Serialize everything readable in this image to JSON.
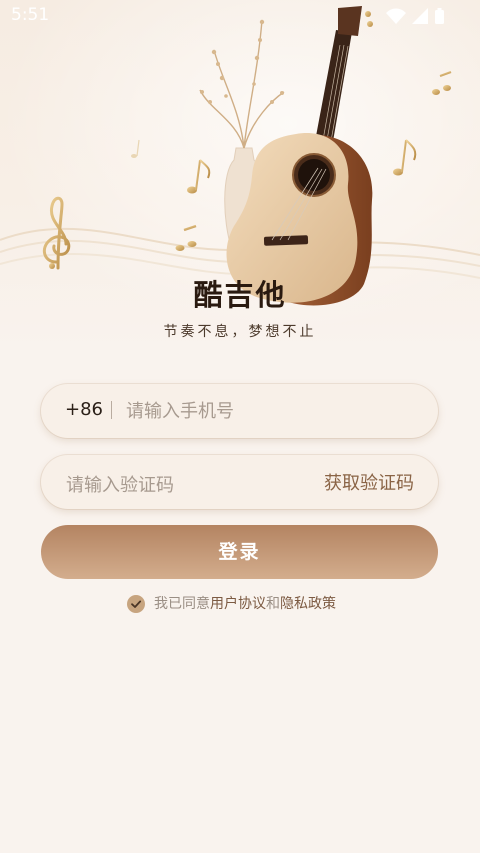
{
  "status_bar": {
    "time": "5:51",
    "icons": [
      "wifi-icon",
      "cellular-signal-icon",
      "battery-icon"
    ]
  },
  "app": {
    "title": "酷吉他",
    "slogan": "节奏不息，梦想不止"
  },
  "hero": {
    "icons": [
      "guitar-illustration",
      "treble-clef-icon",
      "music-note-icon",
      "vase-icon"
    ]
  },
  "login_form": {
    "country_code": "+86",
    "phone_placeholder": "请输入手机号",
    "phone_value": "",
    "code_placeholder": "请输入验证码",
    "code_value": "",
    "get_code_label": "获取验证码",
    "login_label": "登录"
  },
  "agreement": {
    "checked": true,
    "prefix": "我已同意",
    "user_agreement": "用户协议",
    "and": "和",
    "privacy_policy": "隐私政策"
  },
  "colors": {
    "background": "#f9f3ee",
    "accent": "#b48462",
    "accent_light": "#d3ad8d",
    "title": "#2a1a10",
    "link": "#7c5a42",
    "placeholder": "#a79a8f"
  }
}
